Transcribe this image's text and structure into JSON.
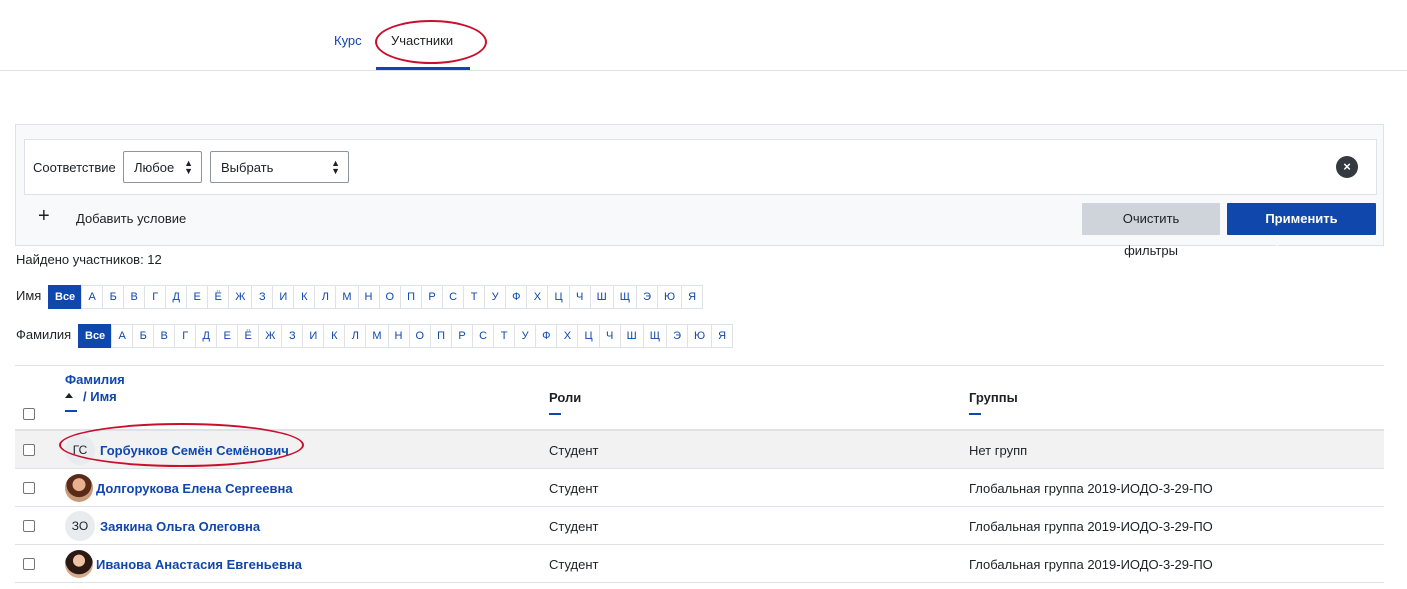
{
  "tabs": {
    "course": "Курс",
    "participants": "Участники"
  },
  "filter": {
    "match_label": "Соответствие",
    "match_value": "Любое",
    "type_value": "Выбрать",
    "add_condition": "Добавить условие",
    "clear_button": "Очистить фильтры",
    "apply_button": "Применить фильтры"
  },
  "found_text": "Найдено участников: 12",
  "initials": {
    "first_label": "Имя",
    "last_label": "Фамилия",
    "all": "Все",
    "letters": [
      "А",
      "Б",
      "В",
      "Г",
      "Д",
      "Е",
      "Ё",
      "Ж",
      "З",
      "И",
      "К",
      "Л",
      "М",
      "Н",
      "О",
      "П",
      "Р",
      "С",
      "Т",
      "У",
      "Ф",
      "Х",
      "Ц",
      "Ч",
      "Ш",
      "Щ",
      "Э",
      "Ю",
      "Я"
    ]
  },
  "table": {
    "headers": {
      "lastname": "Фамилия",
      "firstname": "/ Имя",
      "roles": "Роли",
      "groups": "Группы"
    },
    "rows": [
      {
        "initials": "ГС",
        "name": "Горбунков Семён Семёнович",
        "role": "Студент",
        "group": "Нет групп"
      },
      {
        "initials": "",
        "name": "Долгорукова Елена Сергеевна",
        "role": "Студент",
        "group": "Глобальная группа 2019-ИОДО-3-29-ПО"
      },
      {
        "initials": "ЗО",
        "name": "Заякина Ольга Олеговна",
        "role": "Студент",
        "group": "Глобальная группа 2019-ИОДО-3-29-ПО"
      },
      {
        "initials": "",
        "name": "Иванова Анастасия Евгеньевна",
        "role": "Студент",
        "group": "Глобальная группа 2019-ИОДО-3-29-ПО"
      }
    ]
  },
  "colors": {
    "primary": "#0f47ad",
    "annotation": "#c8102e"
  }
}
